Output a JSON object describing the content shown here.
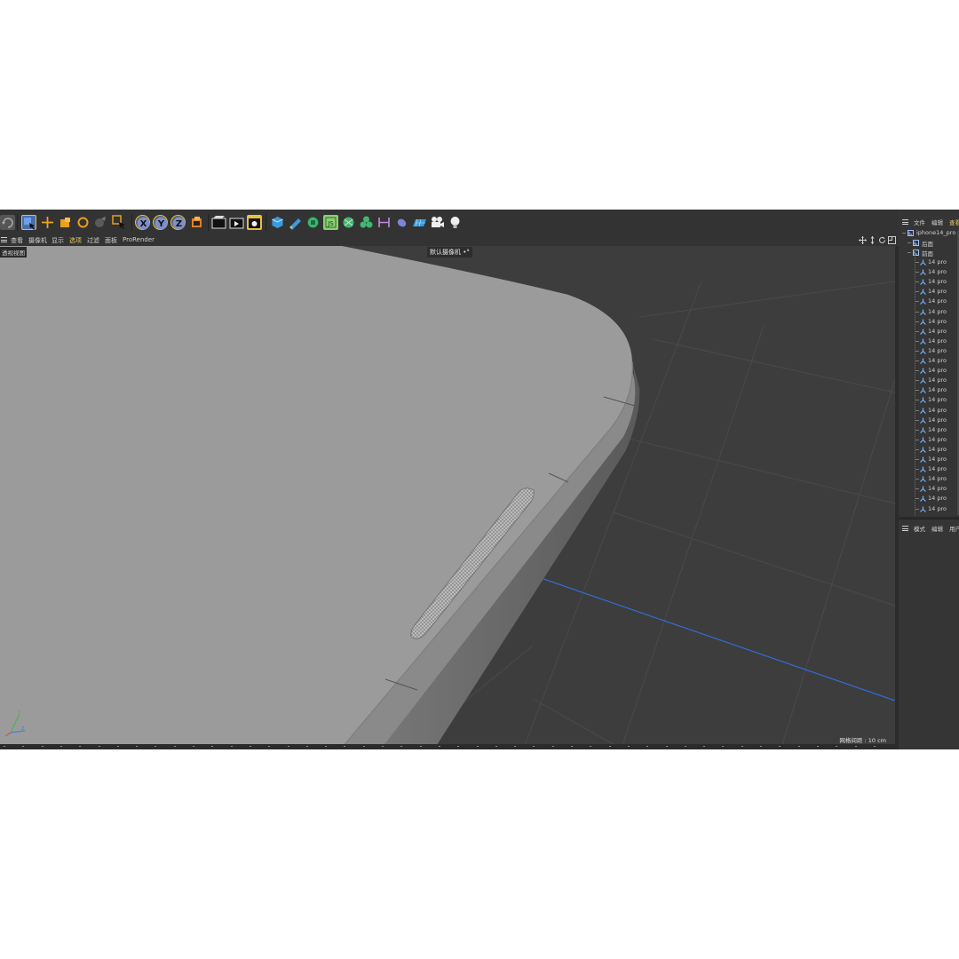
{
  "viewport_menu": {
    "items": [
      "查看",
      "摄像机",
      "显示",
      "选项",
      "过滤",
      "面板",
      "ProRender"
    ],
    "active_item": "选项"
  },
  "viewport": {
    "view_label": "透视视图",
    "camera_label": "默认摄像机 •°",
    "grid_spacing": "网格间距 : 10 cm"
  },
  "object_manager": {
    "tabs": [
      "文件",
      "编辑",
      "查看"
    ],
    "active_tab": "查看",
    "root": "iphone14_pro",
    "groups": [
      "后面",
      "前面"
    ],
    "child_label": "14 pro",
    "child_count": 26
  },
  "attributes": {
    "tabs": [
      "模式",
      "编辑",
      "用户"
    ]
  },
  "toolbar": {
    "icons": [
      "undo-icon",
      "live-selection-icon",
      "move-icon",
      "scale-icon",
      "rotate-icon",
      "recent-tool-icon",
      "selection-filter-icon",
      "x-axis-lock-icon",
      "y-axis-lock-icon",
      "z-axis-lock-icon",
      "coordinate-system-icon",
      "render-view-icon",
      "render-to-picture-viewer-icon",
      "render-settings-icon",
      "cube-icon",
      "pen-icon",
      "subdivision-icon",
      "array-icon",
      "generator-icon",
      "cloner-icon",
      "field-icon",
      "deformer-icon",
      "floor-icon",
      "camera-icon",
      "light-icon"
    ],
    "accent": "#e8c13a"
  },
  "colors": {
    "model_surface": "#9b9b9b",
    "background": "#3d3d3d",
    "axis_line": "#2e6fd8",
    "highlight": "#e9c96a"
  }
}
